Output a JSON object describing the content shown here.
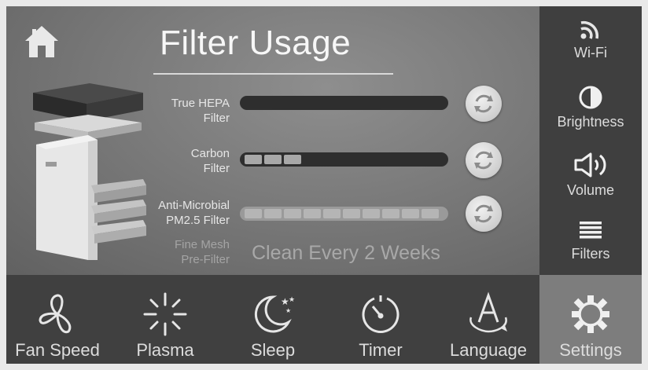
{
  "header": {
    "title": "Filter Usage"
  },
  "filters": [
    {
      "label_line1": "True HEPA",
      "label_line2": "Filter",
      "filled_fraction": 1.0
    },
    {
      "label_line1": "Carbon",
      "label_line2": "Filter",
      "filled_fraction": 0.23
    },
    {
      "label_line1": "Anti-Microbial",
      "label_line2": "PM2.5 Filter",
      "filled_fraction": 0.0
    },
    {
      "label_line1": "Fine Mesh",
      "label_line2": "Pre-Filter",
      "status": "Clean Every 2 Weeks"
    }
  ],
  "sidebar": {
    "items": [
      {
        "label": "Wi-Fi",
        "icon": "wifi-icon"
      },
      {
        "label": "Brightness",
        "icon": "brightness-icon"
      },
      {
        "label": "Volume",
        "icon": "volume-icon"
      },
      {
        "label": "Filters",
        "icon": "filters-icon"
      }
    ]
  },
  "bottombar": {
    "items": [
      {
        "label": "Fan Speed",
        "icon": "fan-icon"
      },
      {
        "label": "Plasma",
        "icon": "plasma-icon"
      },
      {
        "label": "Sleep",
        "icon": "sleep-icon"
      },
      {
        "label": "Timer",
        "icon": "timer-icon"
      },
      {
        "label": "Language",
        "icon": "language-icon"
      },
      {
        "label": "Settings",
        "icon": "settings-icon",
        "active": true
      }
    ]
  },
  "colors": {
    "panel": "#2e2e2e",
    "sidebar": "#3f3f3f",
    "active_tab": "#7d7d7d",
    "text": "#dcdcdc"
  }
}
